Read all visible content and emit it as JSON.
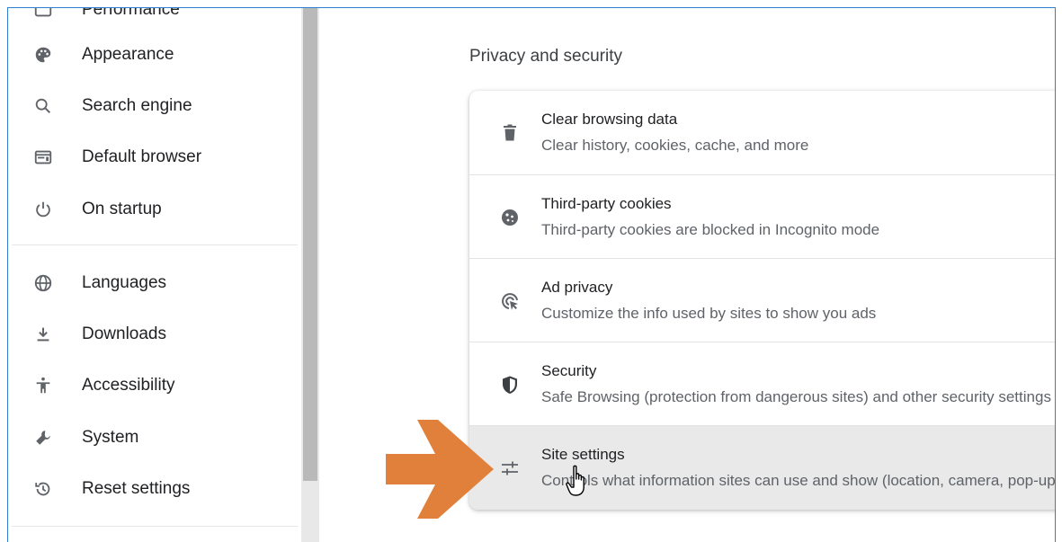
{
  "sidebar": {
    "items": [
      {
        "label": "Performance",
        "icon": "performance-icon"
      },
      {
        "label": "Appearance",
        "icon": "palette-icon"
      },
      {
        "label": "Search engine",
        "icon": "search-icon"
      },
      {
        "label": "Default browser",
        "icon": "browser-window-icon"
      },
      {
        "label": "On startup",
        "icon": "power-icon"
      },
      {
        "label": "Languages",
        "icon": "globe-icon"
      },
      {
        "label": "Downloads",
        "icon": "download-icon"
      },
      {
        "label": "Accessibility",
        "icon": "accessibility-icon"
      },
      {
        "label": "System",
        "icon": "wrench-icon"
      },
      {
        "label": "Reset settings",
        "icon": "reset-history-icon"
      }
    ]
  },
  "main": {
    "section_title": "Privacy and security",
    "rows": [
      {
        "title": "Clear browsing data",
        "subtitle": "Clear history, cookies, cache, and more",
        "icon": "trash-icon"
      },
      {
        "title": "Third-party cookies",
        "subtitle": "Third-party cookies are blocked in Incognito mode",
        "icon": "cookie-icon"
      },
      {
        "title": "Ad privacy",
        "subtitle": "Customize the info used by sites to show you ads",
        "icon": "ad-privacy-icon"
      },
      {
        "title": "Security",
        "subtitle": "Safe Browsing (protection from dangerous sites) and other security settings",
        "icon": "shield-icon"
      },
      {
        "title": "Site settings",
        "subtitle": "Controls what information sites can use and show (location, camera, pop-ups, and more)",
        "icon": "sliders-icon",
        "highlighted": true
      }
    ]
  },
  "annotations": {
    "arrow_color": "#e0803a",
    "arrow_icon": "arrow-right-icon",
    "cursor_icon": "hand-pointer-icon"
  },
  "colors": {
    "frame_border": "#2f7fd0",
    "highlight_row": "#e9e9e9"
  }
}
